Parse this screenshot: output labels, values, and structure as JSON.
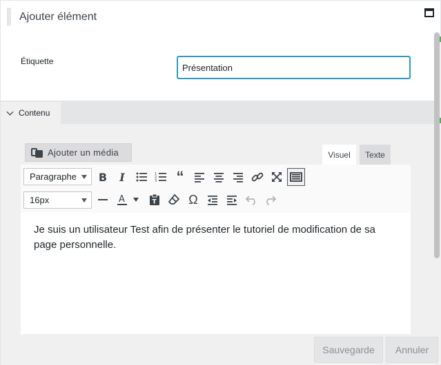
{
  "dialog": {
    "title": "Ajouter élément",
    "maximize_icon": "window-maximize-icon"
  },
  "form": {
    "label_text": "Étiquette",
    "label_value": "Présentation"
  },
  "section": {
    "tab_label": "Contenu",
    "tab_icon": "chevron-down-icon"
  },
  "editor": {
    "add_media_label": "Ajouter un média",
    "add_media_icon": "media-icon",
    "tab_visual": "Visuel",
    "tab_text": "Texte",
    "format_select": "Paragraphe",
    "font_size_select": "16px",
    "toolbar_row1": [
      "bold-icon",
      "italic-icon",
      "bullet-list-icon",
      "numbered-list-icon",
      "blockquote-icon",
      "align-left-icon",
      "align-center-icon",
      "align-right-icon",
      "link-icon",
      "fullscreen-icon",
      "toolbar-toggle-icon"
    ],
    "toolbar_row2": [
      "horizontal-line-icon",
      "text-color-icon",
      "paste-text-icon",
      "clear-formatting-icon",
      "special-character-icon",
      "outdent-icon",
      "indent-icon",
      "undo-icon",
      "redo-icon"
    ],
    "content": "Je suis un utilisateur Test afin de présenter le tutoriel de modification de sa page personnelle."
  },
  "footer": {
    "save_label": "Sauvegarde",
    "cancel_label": "Annuler"
  },
  "colors": {
    "focus_border": "#2e97c9",
    "panel_bg": "#f0f0f1",
    "button_bg": "#e4e5e7"
  }
}
